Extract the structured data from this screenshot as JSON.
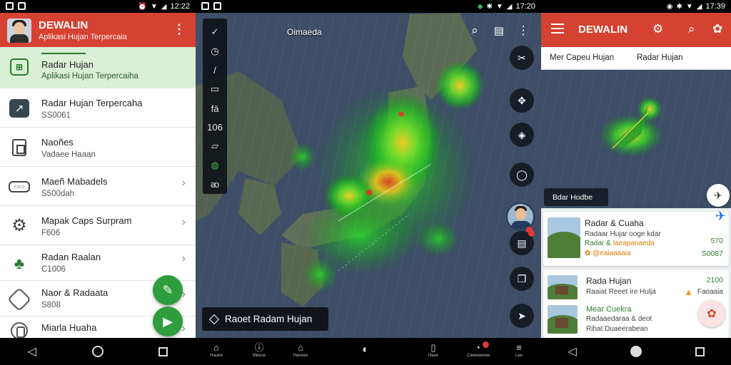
{
  "status": {
    "time1": "12:22",
    "time2": "17:20",
    "time3": "17:39"
  },
  "drawer": {
    "title": "DEWALIN",
    "subtitle": "Aplikasi Hujan Terpercaia",
    "menu_icon": "more-vert-icon",
    "items": [
      {
        "label": "Radar Hujan",
        "value": "Aplikasi Hujan Terpercaiha",
        "icon": "radar-icon",
        "active": true
      },
      {
        "label": "Radar Hujan Terpercaha",
        "value": "SS0061",
        "icon": "chart-icon"
      },
      {
        "label": "Naoñes",
        "value": "Vadaee Haaan",
        "icon": "document-icon"
      },
      {
        "label": "Maeñ Mabadels",
        "value": "S500dah",
        "icon": "pill-icon",
        "chevron": true
      },
      {
        "label": "Mapak Caps Surpram",
        "value": "F606",
        "icon": "gear-icon",
        "chevron": true
      },
      {
        "label": "Radan Raalan",
        "value": "C1006",
        "icon": "leaf-icon",
        "chevron": true
      },
      {
        "label": "Naor & Radaata",
        "value": "S808",
        "icon": "octagon-icon",
        "chevron": true
      },
      {
        "label": "Miarla Huaha",
        "value": "",
        "icon": "ring-icon",
        "chevron": true
      }
    ],
    "fab_edit_icon": "edit-icon",
    "fab_play_icon": "play-icon"
  },
  "map": {
    "location": "Oimaeda",
    "rail_icons": [
      "check-icon",
      "clock-icon",
      "pencil-icon",
      "layers-icon",
      "list-icon",
      "timer-icon",
      "frame-icon",
      "leaf-icon",
      "film-icon"
    ],
    "rail_labels": [
      "✓",
      "◷",
      "/",
      "▭",
      "fā",
      "106",
      "▱",
      "◍",
      "ᴔ"
    ],
    "chip_label": "Raoet Radam Hujan",
    "bottom_items": [
      {
        "label": "Hauee",
        "icon": "home-icon"
      },
      {
        "label": "Meeoe",
        "icon": "help-icon"
      },
      {
        "label": "Haoeee",
        "icon": "house-icon"
      },
      {
        "label": "",
        "icon": "radar-icon"
      },
      {
        "label": "Haee",
        "icon": "doc-icon"
      },
      {
        "label": "Cleeeaeeee",
        "icon": "speed-icon"
      },
      {
        "label": "Lee",
        "icon": "menu-icon"
      }
    ]
  },
  "detail": {
    "title": "DEWALIN",
    "tabs": [
      "Mer Capeu Hujan",
      "Radar Hujan"
    ],
    "map_label": "Bdar Hodbe",
    "cards": [
      {
        "title": "Radar & Cuaha",
        "line1": "Radaar Hujar ooge kdar",
        "line2a": "Radar & ",
        "line2b": "Iaeapanaeda",
        "line3": "✿ @eaiaaaaia",
        "num1": "570",
        "num2": "S0087"
      },
      {
        "title": "Rada Hujan",
        "line1": "Raaiat Reeet ire Hulja",
        "line2": "Mear Cuekra",
        "line3": "Radaaedaraa & deot",
        "line4": "Rihat Duaeerabean",
        "num1": "2100",
        "num2": "Faoaaia"
      }
    ]
  },
  "colors": {
    "brand_red": "#d64232",
    "accent_green": "#2e9d3e",
    "active_row": "#daf0d6",
    "map_bg": "#3d4e66"
  }
}
